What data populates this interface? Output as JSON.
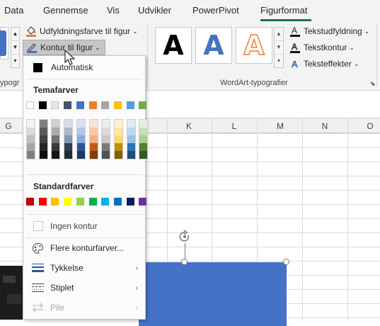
{
  "tabs": {
    "items": [
      "Data",
      "Gennemse",
      "Vis",
      "Udvikler",
      "PowerPivot",
      "Figurformat"
    ],
    "active": "Figurformat"
  },
  "ribbon": {
    "fill_label": "Udfyldningsfarve til figur",
    "outline_label": "Kontur til figur",
    "group_left_label": "ypogr",
    "wordart_group_label": "WordArt-typografier",
    "wordart_letter": "A",
    "text_fill_label": "Tekstudfyldning",
    "text_outline_label": "Tekstkontur",
    "text_effects_label": "Teksteffekter"
  },
  "columns": [
    "G",
    "K",
    "L",
    "M",
    "N",
    "O"
  ],
  "dropdown": {
    "automatic_label": "Automatisk",
    "theme_colors_heading": "Temafarver",
    "standard_colors_heading": "Standardfarver",
    "no_outline_label": "Ingen kontur",
    "more_colors_label": "Flere konturfarver...",
    "weight_label": "Tykkelse",
    "dashes_label": "Stiplet",
    "arrows_label": "Pile",
    "theme_colors": [
      "#ffffff",
      "#000000",
      "#e7e6e6",
      "#44546a",
      "#4472c4",
      "#ed7d31",
      "#a5a5a5",
      "#ffc000",
      "#5b9bd5",
      "#70ad47"
    ],
    "theme_shades": [
      [
        "#f2f2f2",
        "#d9d9d9",
        "#bfbfbf",
        "#a6a6a6",
        "#808080"
      ],
      [
        "#808080",
        "#595959",
        "#404040",
        "#262626",
        "#0d0d0d"
      ],
      [
        "#d0cece",
        "#aeaaaa",
        "#757171",
        "#3a3838",
        "#171616"
      ],
      [
        "#d6dce4",
        "#adb9ca",
        "#8497b0",
        "#333f4f",
        "#222a35"
      ],
      [
        "#d9e1f2",
        "#b4c6e7",
        "#8ea9db",
        "#2f5597",
        "#1f3864"
      ],
      [
        "#fce4d6",
        "#f8cbad",
        "#f4b084",
        "#c65911",
        "#843c0c"
      ],
      [
        "#ededed",
        "#dbdbdb",
        "#c9c9c9",
        "#7b7b7b",
        "#525252"
      ],
      [
        "#fff2cc",
        "#ffe699",
        "#ffd966",
        "#bf8f00",
        "#806000"
      ],
      [
        "#ddebf7",
        "#bdd7ee",
        "#9bc2e6",
        "#2e75b6",
        "#1f4e78"
      ],
      [
        "#e2efda",
        "#c6e0b4",
        "#a9d08e",
        "#548235",
        "#375623"
      ]
    ],
    "standard_colors": [
      "#c00000",
      "#ff0000",
      "#ffc000",
      "#ffff00",
      "#92d050",
      "#00b050",
      "#00b0f0",
      "#0070c0",
      "#002060",
      "#7030a0"
    ]
  }
}
